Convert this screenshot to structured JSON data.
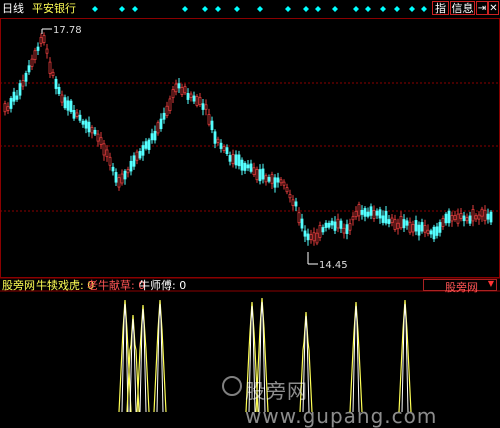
{
  "header": {
    "period_label": "日线",
    "stock_name": "平安银行",
    "btn_indicator": "指",
    "btn_info": "信息"
  },
  "main_chart": {
    "high_label": "17.78",
    "low_label": "14.45"
  },
  "sub_panel": {
    "name": "股旁网",
    "series": [
      {
        "label": "牛犊戏虎: 0",
        "color": "#ffff55"
      },
      {
        "label": "老牛献草: 0",
        "color": "#ff5555"
      },
      {
        "label": "牛师傅: 0",
        "color": "#ffffff"
      }
    ],
    "selector_value": "股旁网"
  },
  "watermark": "股旁网 www.gupang.com",
  "colors": {
    "up": "#e03c3c",
    "down": "#54ffff",
    "grid": "#8b0000",
    "signal": "#00ffff",
    "spike_yellow": "#ffff55",
    "spike_white": "#ffffff"
  }
}
